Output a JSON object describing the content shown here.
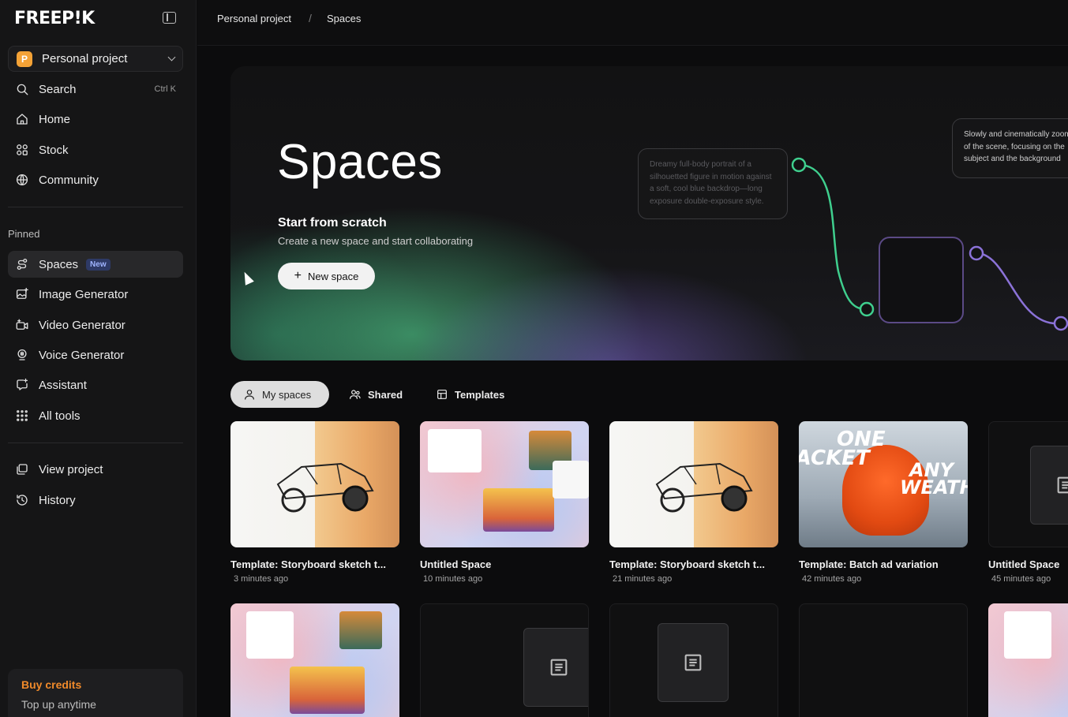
{
  "app": {
    "logo": "FREEP!K"
  },
  "sidebar": {
    "project": {
      "badge": "P",
      "name": "Personal project"
    },
    "search": {
      "label": "Search",
      "shortcut": "Ctrl K"
    },
    "nav": [
      {
        "label": "Home",
        "icon": "home-icon"
      },
      {
        "label": "Stock",
        "icon": "stock-icon"
      },
      {
        "label": "Community",
        "icon": "globe-icon"
      }
    ],
    "pinned_label": "Pinned",
    "pinned": [
      {
        "label": "Spaces",
        "icon": "spaces-icon",
        "badge": "New"
      },
      {
        "label": "Image Generator",
        "icon": "image-generator-icon"
      },
      {
        "label": "Video Generator",
        "icon": "video-generator-icon"
      },
      {
        "label": "Voice Generator",
        "icon": "voice-generator-icon"
      },
      {
        "label": "Assistant",
        "icon": "assistant-icon"
      },
      {
        "label": "All tools",
        "icon": "grid-icon"
      }
    ],
    "project_links": [
      {
        "label": "View project",
        "icon": "view-project-icon"
      },
      {
        "label": "History",
        "icon": "history-icon"
      }
    ],
    "buy": {
      "title": "Buy credits",
      "subtitle": "Top up anytime"
    }
  },
  "breadcrumb": {
    "project": "Personal project",
    "separator": "/",
    "current": "Spaces"
  },
  "hero": {
    "title": "Spaces",
    "subtitle": "Start from scratch",
    "description": "Create a new space and start collaborating",
    "button_label": "New space",
    "prompt_a": "Dreamy full-body portrait of a silhouetted figure in motion against a soft, cool blue backdrop—long exposure double-exposure style.",
    "prompt_b": "Slowly and cinematically zoom of the scene, focusing on the subject and the background"
  },
  "tabs": [
    {
      "label": "My spaces",
      "icon": "user-icon",
      "active": true
    },
    {
      "label": "Shared",
      "icon": "shared-icon",
      "active": false
    },
    {
      "label": "Templates",
      "icon": "templates-icon",
      "active": false
    }
  ],
  "spaces": [
    {
      "title": "Template: Storyboard sketch t...",
      "time": "3 minutes ago",
      "thumb": "sketch"
    },
    {
      "title": "Untitled Space",
      "time": "10 minutes ago",
      "thumb": "collage"
    },
    {
      "title": "Template: Storyboard sketch t...",
      "time": "21 minutes ago",
      "thumb": "sketch"
    },
    {
      "title": "Template: Batch ad variation",
      "time": "42 minutes ago",
      "thumb": "jacket"
    },
    {
      "title": "Untitled Space",
      "time": "45 minutes ago",
      "thumb": "dark-doc"
    }
  ],
  "jacket_words": {
    "line1": "ONE",
    "line2": "JACKET",
    "line3": "ANY",
    "line4": "WEATHER"
  },
  "colors": {
    "accent": "#f4a236",
    "buy_credits": "#f08a2a",
    "new_badge": "#9fb4ff",
    "link_green": "#3fcf8e",
    "link_purple": "#8b72d8"
  }
}
